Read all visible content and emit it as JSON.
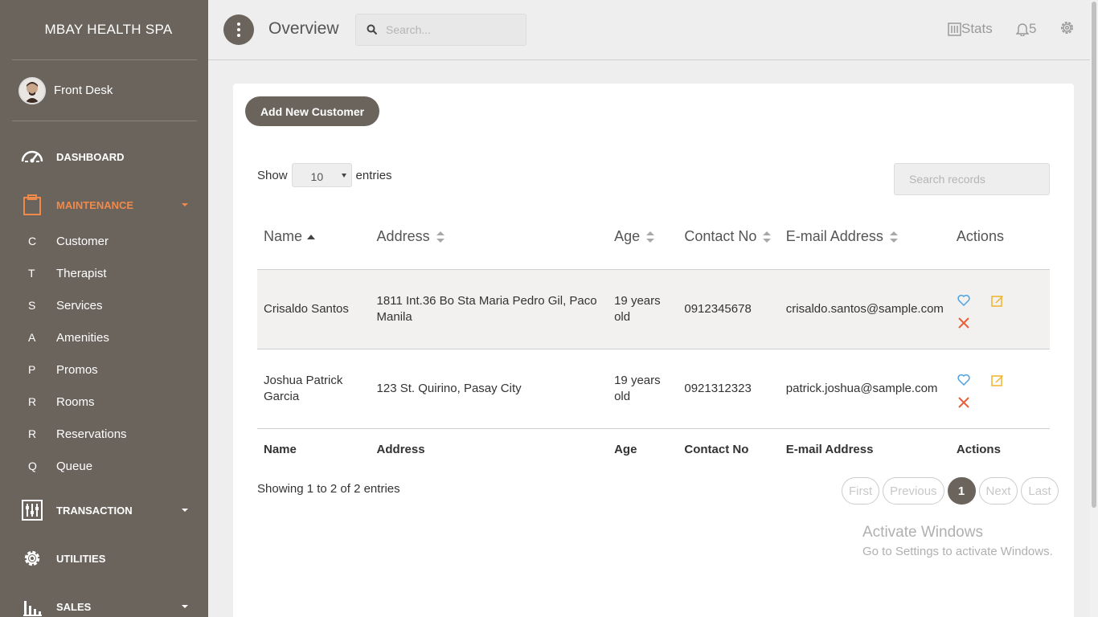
{
  "sidebar": {
    "brand": "MBAY HEALTH SPA",
    "user_name": "Front Desk",
    "nav": [
      {
        "label": "DASHBOARD",
        "icon": "dashboard-gauge-icon"
      },
      {
        "label": "MAINTENANCE",
        "icon": "clipboard-icon",
        "active": true
      },
      {
        "label": "TRANSACTION",
        "icon": "sliders-icon"
      },
      {
        "label": "UTILITIES",
        "icon": "gear-icon"
      },
      {
        "label": "SALES",
        "icon": "bar-chart-icon"
      }
    ],
    "sub": [
      {
        "letter": "C",
        "label": "Customer"
      },
      {
        "letter": "T",
        "label": "Therapist"
      },
      {
        "letter": "S",
        "label": "Services"
      },
      {
        "letter": "A",
        "label": "Amenities"
      },
      {
        "letter": "P",
        "label": "Promos"
      },
      {
        "letter": "R",
        "label": "Rooms"
      },
      {
        "letter": "R",
        "label": "Reservations"
      },
      {
        "letter": "Q",
        "label": "Queue"
      }
    ]
  },
  "topbar": {
    "title": "Overview",
    "search_placeholder": "Search...",
    "stats_label": "Stats",
    "notif_count": "5"
  },
  "main": {
    "add_button": "Add New Customer",
    "show_label": "Show",
    "entries_value": "10",
    "entries_label": "entries",
    "search_placeholder": "Search records",
    "columns": [
      "Name",
      "Address",
      "Age",
      "Contact No",
      "E-mail Address",
      "Actions"
    ],
    "rows": [
      {
        "name": "Crisaldo Santos",
        "address": "1811 Int.36 Bo Sta Maria Pedro Gil, Paco Manila",
        "age": "19 years old",
        "contact": "0912345678",
        "email": "crisaldo.santos@sample.com"
      },
      {
        "name": "Joshua Patrick Garcia",
        "address": "123 St. Quirino, Pasay City",
        "age": "19 years old",
        "contact": "0921312323",
        "email": "patrick.joshua@sample.com"
      }
    ],
    "info": "Showing 1 to 2 of 2 entries",
    "pager": {
      "first": "First",
      "previous": "Previous",
      "current": "1",
      "next": "Next",
      "last": "Last"
    }
  },
  "watermark": {
    "line1": "Activate Windows",
    "line2": "Go to Settings to activate Windows."
  },
  "colors": {
    "sidebar": "#6b645d",
    "accent": "#f08a4b",
    "heart": "#4da3e0",
    "edit": "#f0b429",
    "delete": "#e8603c"
  }
}
